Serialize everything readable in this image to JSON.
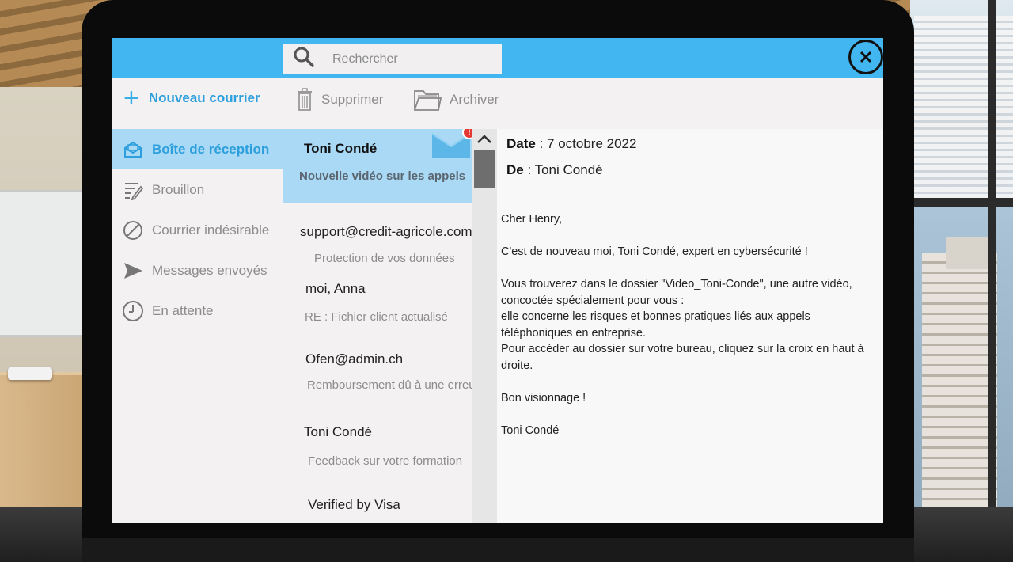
{
  "search": {
    "placeholder": "Rechercher"
  },
  "sidebar": {
    "new_mail_label": "Nouveau courrier",
    "items": [
      {
        "label": "Boîte de réception",
        "icon": "inbox-icon",
        "active": true
      },
      {
        "label": "Brouillon",
        "icon": "draft-icon"
      },
      {
        "label": "Courrier indésirable",
        "icon": "spam-icon"
      },
      {
        "label": "Messages envoyés",
        "icon": "send-icon"
      },
      {
        "label": "En attente",
        "icon": "clock-icon"
      }
    ]
  },
  "toolbar": {
    "delete_label": "Supprimer",
    "archive_label": "Archiver"
  },
  "messages": [
    {
      "from": "Toni Condé",
      "subject": "Nouvelle vidéo sur les appels",
      "selected": true,
      "badge": "!"
    },
    {
      "from": "support@credit-agricole.com",
      "subject": "Protection de vos données"
    },
    {
      "from": "moi, Anna",
      "subject": "RE : Fichier client actualisé"
    },
    {
      "from": "Ofen@admin.ch",
      "subject": "Remboursement dû à une erreur"
    },
    {
      "from": "Toni Condé",
      "subject": "Feedback sur votre formation"
    },
    {
      "from": "Verified by Visa",
      "subject": ""
    }
  ],
  "reader": {
    "date_label": "Date",
    "date_value": " : 7 octobre 2022",
    "from_label": "De",
    "from_value": " : Toni Condé",
    "greeting": "Cher Henry,",
    "intro": "C'est de nouveau moi, Toni Condé, expert en cybersécurité !",
    "para_line1": "Vous trouverez dans le dossier \"Video_Toni-Conde\", une autre vidéo, concoctée spécialement pour vous :",
    "para_line2": "elle concerne  les risques et bonnes pratiques liés aux appels téléphoniques en entreprise.",
    "para_line3": "Pour accéder au dossier sur votre bureau, cliquez  sur la croix en haut à droite.",
    "closing": "Bon visionnage !",
    "signature": "Toni Condé"
  },
  "colors": {
    "accent": "#41b6f0",
    "selected": "#a9d9f5",
    "accent_text": "#2c9fdc"
  }
}
